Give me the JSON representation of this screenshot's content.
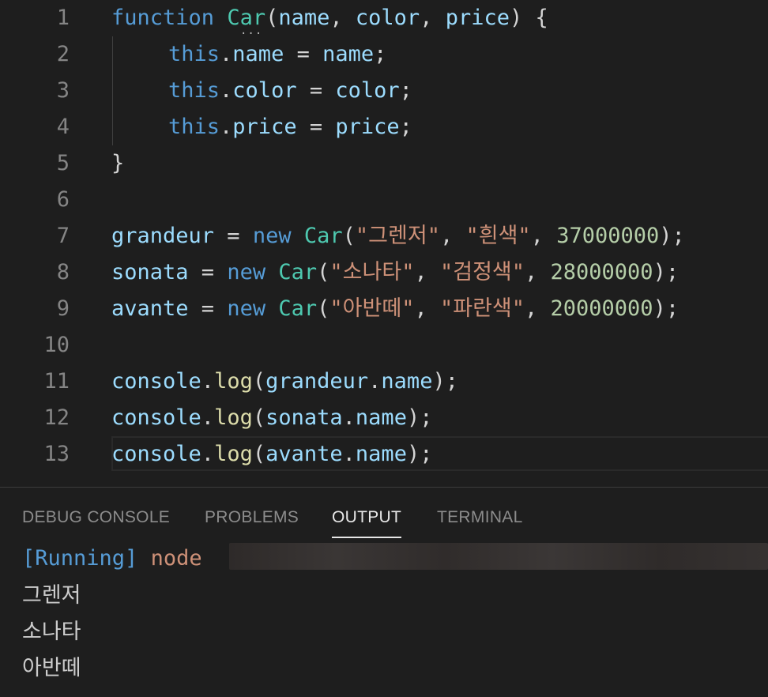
{
  "editor": {
    "line_numbers": [
      "1",
      "2",
      "3",
      "4",
      "5",
      "6",
      "7",
      "8",
      "9",
      "10",
      "11",
      "12",
      "13"
    ],
    "colors": {
      "keyword": "#569cd6",
      "function": "#dcdcaa",
      "class": "#4ec9b0",
      "variable": "#9cdcfe",
      "string": "#ce9178",
      "number": "#b5cea8",
      "background": "#1e1e1e"
    },
    "line1": {
      "kw": "function",
      "name": "Car",
      "open": "(",
      "p1": "name",
      "c1": ", ",
      "p2": "color",
      "c2": ", ",
      "p3": "price",
      "close": ") {"
    },
    "line2": {
      "this": "this",
      "dot": ".",
      "prop": "name",
      "eq": " = ",
      "val": "name",
      "semi": ";"
    },
    "line3": {
      "this": "this",
      "dot": ".",
      "prop": "color",
      "eq": " = ",
      "val": "color",
      "semi": ";"
    },
    "line4": {
      "this": "this",
      "dot": ".",
      "prop": "price",
      "eq": " = ",
      "val": "price",
      "semi": ";"
    },
    "line5": {
      "brace": "}"
    },
    "line7": {
      "var": "grandeur",
      "eq": " = ",
      "new": "new",
      "sp": " ",
      "cls": "Car",
      "open": "(",
      "s1": "\"그렌저\"",
      "c1": ", ",
      "s2": "\"흰색\"",
      "c2": ", ",
      "num": "37000000",
      "close": ");"
    },
    "line8": {
      "var": "sonata",
      "eq": " = ",
      "new": "new",
      "sp": " ",
      "cls": "Car",
      "open": "(",
      "s1": "\"소나타\"",
      "c1": ", ",
      "s2": "\"검정색\"",
      "c2": ", ",
      "num": "28000000",
      "close": ");"
    },
    "line9": {
      "var": "avante",
      "eq": " = ",
      "new": "new",
      "sp": " ",
      "cls": "Car",
      "open": "(",
      "s1": "\"아반떼\"",
      "c1": ", ",
      "s2": "\"파란색\"",
      "c2": ", ",
      "num": "20000000",
      "close": ");"
    },
    "line11": {
      "obj": "console",
      "dot": ".",
      "fn": "log",
      "open": "(",
      "arg": "grandeur",
      "dot2": ".",
      "prop": "name",
      "close": ");"
    },
    "line12": {
      "obj": "console",
      "dot": ".",
      "fn": "log",
      "open": "(",
      "arg": "sonata",
      "dot2": ".",
      "prop": "name",
      "close": ");"
    },
    "line13": {
      "obj": "console",
      "dot": ".",
      "fn": "log",
      "open": "(",
      "arg": "avante",
      "dot2": ".",
      "prop": "name",
      "close": ");"
    }
  },
  "panel": {
    "tabs": [
      {
        "label": "DEBUG CONSOLE"
      },
      {
        "label": "PROBLEMS"
      },
      {
        "label": "OUTPUT",
        "active": true
      },
      {
        "label": "TERMINAL"
      }
    ],
    "running_label": "[Running]",
    "running_cmd": "node",
    "output_lines": [
      "그렌저",
      "소나타",
      "아반떼"
    ]
  }
}
